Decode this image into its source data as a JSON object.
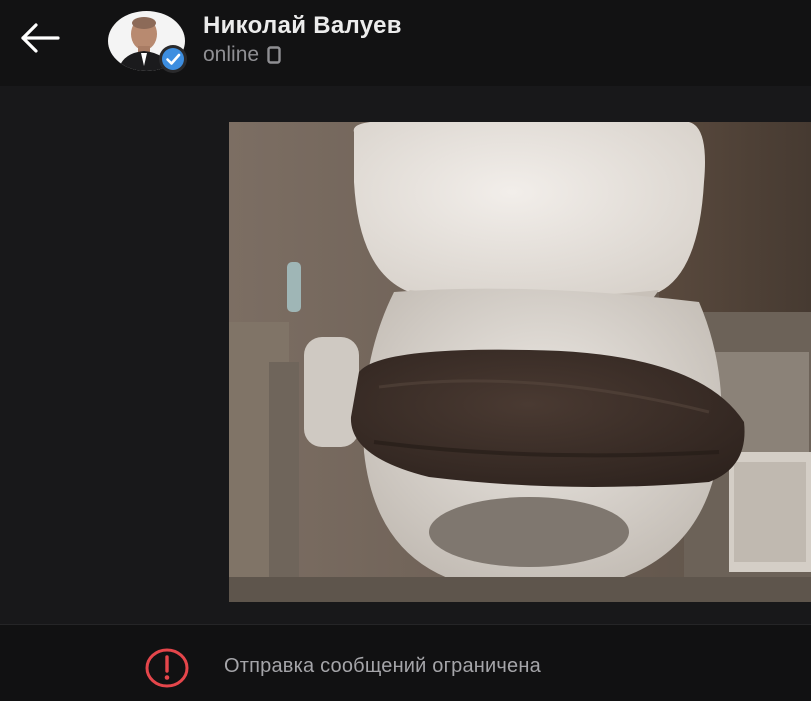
{
  "header": {
    "back_icon": "arrow-left-icon",
    "contact_name": "Николай Валуев",
    "status": "online",
    "status_icon": "device-icon",
    "verified_icon": "verified-check-icon"
  },
  "message": {
    "type": "photo"
  },
  "footer": {
    "restriction_text": "Отправка сообщений ограничена",
    "restriction_icon": "exclamation-circle-icon",
    "warning_color": "#e5464b"
  },
  "colors": {
    "background": "#121213",
    "chat_background": "#18181a",
    "verified_badge": "#3d8ee0"
  }
}
